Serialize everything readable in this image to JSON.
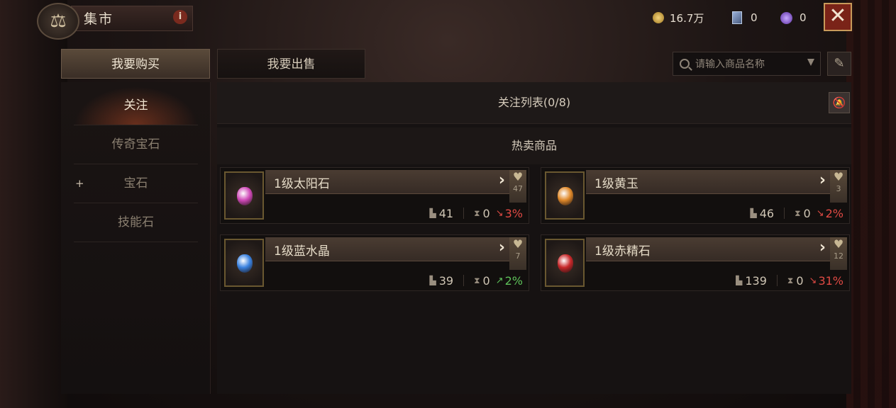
{
  "header": {
    "title": "集市",
    "info_icon": "i",
    "close_icon": "✕",
    "currencies": [
      {
        "name": "gold-coin",
        "value": "16.7万"
      },
      {
        "name": "card",
        "value": "0"
      },
      {
        "name": "orb",
        "value": "0"
      }
    ]
  },
  "tabs": {
    "buy": "我要购买",
    "sell": "我要出售"
  },
  "search": {
    "placeholder": "请输入商品名称"
  },
  "sidebar": {
    "items": [
      {
        "label": "关注",
        "active": true
      },
      {
        "label": "传奇宝石"
      },
      {
        "label": "宝石",
        "prefix": "+"
      },
      {
        "label": "技能石"
      }
    ]
  },
  "watchlist": {
    "title": "关注列表(0/8)"
  },
  "hot": {
    "title": "热卖商品",
    "items": [
      {
        "name": "1级太阳石",
        "favorites": "47",
        "listings": "41",
        "pending": "0",
        "change": "3%",
        "trend": "down",
        "gem_color": "#d04ab8"
      },
      {
        "name": "1级黄玉",
        "favorites": "3",
        "listings": "46",
        "pending": "0",
        "change": "2%",
        "trend": "down",
        "gem_color": "#e0892a"
      },
      {
        "name": "1级蓝水晶",
        "favorites": "7",
        "listings": "39",
        "pending": "0",
        "change": "2%",
        "trend": "up",
        "gem_color": "#3a82e0"
      },
      {
        "name": "1级赤精石",
        "favorites": "12",
        "listings": "139",
        "pending": "0",
        "change": "31%",
        "trend": "down",
        "gem_color": "#c8282a"
      }
    ]
  }
}
